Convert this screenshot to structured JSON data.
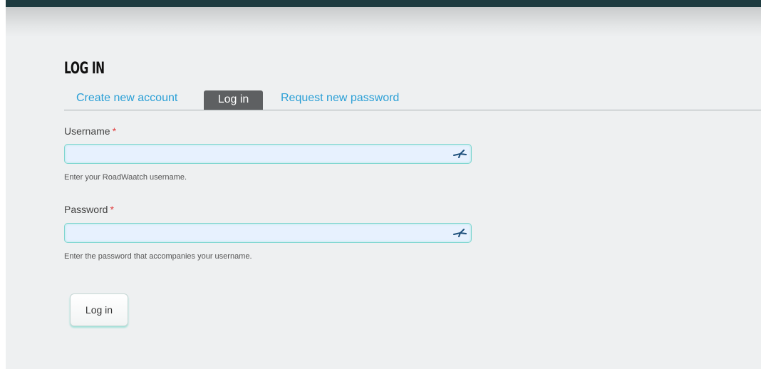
{
  "page": {
    "title": "LOG IN"
  },
  "tabs": [
    {
      "label": "Create new account",
      "active": false
    },
    {
      "label": "Log in",
      "active": true
    },
    {
      "label": "Request new password",
      "active": false
    }
  ],
  "form": {
    "username": {
      "label": "Username",
      "required_marker": "*",
      "value": "",
      "description": "Enter your RoadWaatch username."
    },
    "password": {
      "label": "Password",
      "required_marker": "*",
      "value": "",
      "description": "Enter the password that accompanies your username."
    },
    "submit_label": "Log in",
    "field_icon": "key-icon"
  },
  "colors": {
    "top_bar": "#1e3b40",
    "link": "#2a9fd6",
    "active_tab": "#5e6062",
    "required": "#e03e3e",
    "input_border": "#7fd6d0",
    "input_fill": "#e7f1fe"
  }
}
